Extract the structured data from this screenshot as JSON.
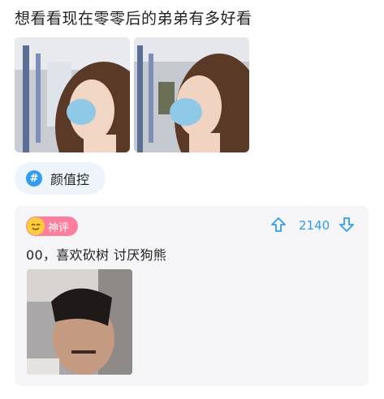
{
  "post": {
    "title": "想看看现在零零后的弟弟有多好看",
    "images": [
      "photo-side-mask-1",
      "photo-side-mask-2"
    ]
  },
  "tag": {
    "icon": "hashtag-icon",
    "symbol": "#",
    "label": "颜值控",
    "color": "#2f9cf5"
  },
  "comment": {
    "badge_label": "神评",
    "badge_color": "#ff7d9d",
    "vote_count": "2140",
    "vote_color": "#2f9cf5",
    "text": "00，喜欢砍树 讨厌狗熊",
    "image": "selfie-photo"
  }
}
